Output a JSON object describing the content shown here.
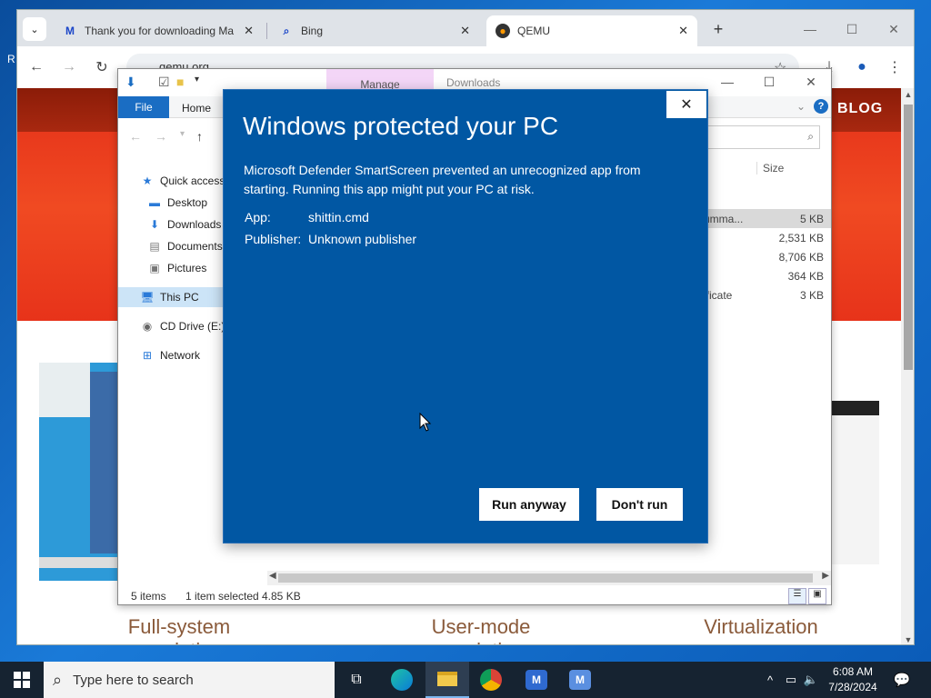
{
  "browser": {
    "tabs": [
      {
        "title": "Thank you for downloading Ma",
        "favicon": "malwarebytes-icon"
      },
      {
        "title": "Bing",
        "favicon": "search-icon"
      },
      {
        "title": "QEMU",
        "favicon": "qemu-icon",
        "active": true
      }
    ],
    "new_tab": "+",
    "url": "qemu.org",
    "page": {
      "blog_link": "BLOG",
      "features": [
        "Full-system emulation",
        "User-mode emulation",
        "Virtualization"
      ]
    }
  },
  "explorer": {
    "title_tab_manage": "Manage",
    "title_tab_downloads": "Downloads",
    "ribbon": {
      "file": "File",
      "home": "Home"
    },
    "nav_items": [
      {
        "label": "Quick access",
        "icon": "star-icon"
      },
      {
        "label": "Desktop",
        "icon": "desktop-folder-icon"
      },
      {
        "label": "Downloads",
        "icon": "downloads-folder-icon"
      },
      {
        "label": "Documents",
        "icon": "documents-folder-icon"
      },
      {
        "label": "Pictures",
        "icon": "pictures-folder-icon"
      },
      {
        "label": "This PC",
        "icon": "computer-icon",
        "selected": true
      },
      {
        "label": "CD Drive (E:) v",
        "icon": "cd-drive-icon"
      },
      {
        "label": "Network",
        "icon": "network-icon"
      }
    ],
    "columns": {
      "size": "Size"
    },
    "files": [
      {
        "name": "umma...",
        "size": "5 KB",
        "selected": true
      },
      {
        "name": "",
        "size": "2,531 KB"
      },
      {
        "name": "",
        "size": "8,706 KB"
      },
      {
        "name": "",
        "size": "364 KB"
      },
      {
        "name": "ificate",
        "size": "3 KB"
      }
    ],
    "status": {
      "items": "5 items",
      "selected": "1 item selected",
      "size": "4.85 KB"
    }
  },
  "smartscreen": {
    "title": "Windows protected your PC",
    "message": "Microsoft Defender SmartScreen prevented an unrecognized app from starting. Running this app might put your PC at risk.",
    "app_label": "App:",
    "app_value": "shittin.cmd",
    "publisher_label": "Publisher:",
    "publisher_value": "Unknown publisher",
    "run_anyway": "Run anyway",
    "dont_run": "Don't run",
    "background_color": "#0157a3"
  },
  "taskbar": {
    "search_placeholder": "Type here to search",
    "apps": [
      "task-view-icon",
      "edge-icon",
      "file-explorer-icon",
      "chrome-icon",
      "malwarebytes-icon",
      "malwarebytes-installer-icon"
    ],
    "time": "6:08 AM",
    "date": "7/28/2024"
  }
}
